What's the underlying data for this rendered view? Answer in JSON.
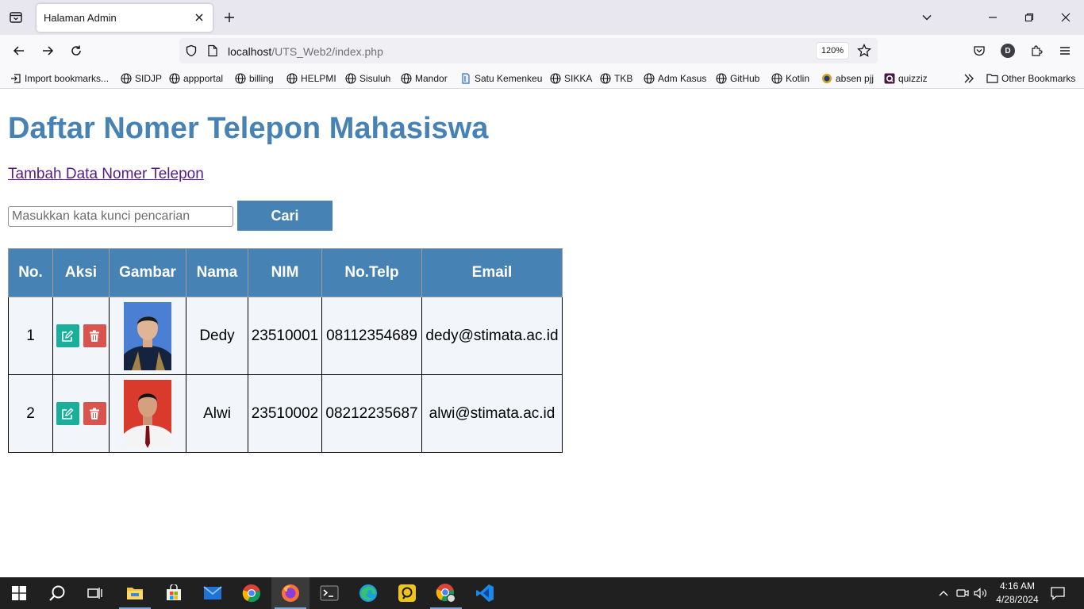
{
  "browser": {
    "tab_title": "Halaman Admin",
    "url_host": "localhost",
    "url_path": "/UTS_Web2/index.php",
    "zoom": "120%",
    "profile_initial": "D"
  },
  "bookmarks": [
    {
      "label": "Import bookmarks...",
      "icon": "import-icon"
    },
    {
      "label": "SIDJP",
      "icon": "globe-icon"
    },
    {
      "label": "appportal",
      "icon": "globe-icon"
    },
    {
      "label": "billing",
      "icon": "globe-icon"
    },
    {
      "label": "HELPMI",
      "icon": "globe-icon"
    },
    {
      "label": "Sisuluh",
      "icon": "globe-icon"
    },
    {
      "label": "Mandor",
      "icon": "globe-icon"
    },
    {
      "label": "Satu Kemenkeu",
      "icon": "kemenkeu-icon"
    },
    {
      "label": "SIKKA",
      "icon": "globe-icon"
    },
    {
      "label": "TKB",
      "icon": "globe-icon"
    },
    {
      "label": "Adm Kasus",
      "icon": "globe-icon"
    },
    {
      "label": "GitHub",
      "icon": "globe-icon"
    },
    {
      "label": "Kotlin",
      "icon": "globe-icon"
    },
    {
      "label": "absen pjj",
      "icon": "emblem-icon"
    },
    {
      "label": "quizziz",
      "icon": "quizziz-icon"
    }
  ],
  "other_bookmarks": "Other Bookmarks",
  "page": {
    "title": "Daftar Nomer Telepon Mahasiswa",
    "add_link": "Tambah Data Nomer Telepon",
    "search_placeholder": "Masukkan kata kunci pencarian",
    "search_button": "Cari"
  },
  "table": {
    "headers": [
      "No.",
      "Aksi",
      "Gambar",
      "Nama",
      "NIM",
      "No.Telp",
      "Email"
    ],
    "rows": [
      {
        "no": "1",
        "nama": "Dedy",
        "nim": "23510001",
        "telp": "08112354689",
        "email": "dedy@stimata.ac.id",
        "photo_bg": "#4a7fd4"
      },
      {
        "no": "2",
        "nama": "Alwi",
        "nim": "23510002",
        "telp": "08212235687",
        "email": "alwi@stimata.ac.id",
        "photo_bg": "#d93a2b"
      }
    ]
  },
  "taskbar": {
    "time": "4:16 AM",
    "date": "4/28/2024"
  },
  "colors": {
    "accent": "#4682b4",
    "edit": "#1aaf9a",
    "delete": "#d9534f"
  }
}
